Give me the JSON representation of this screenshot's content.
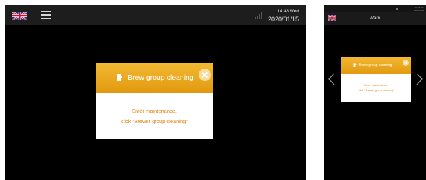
{
  "main_screen": {
    "status": {
      "time": "14:48 Wed",
      "date": "2020/01/15",
      "flag_icon": "uk-flag-icon",
      "menu_icon": "hamburger-menu-icon",
      "signal_icon": "signal-strength-icon"
    },
    "dialog": {
      "title": "Brew group cleaning",
      "title_icon": "brew-group-icon",
      "close_icon": "close-icon",
      "message_line1": "Enter maintenance,",
      "message_line2": "click \"Brewer group cleaning\""
    }
  },
  "side_screen": {
    "status_text_line1": "14:18 Thu",
    "status_text_line2": "2020/01/16",
    "header_title": "Warn",
    "flag_icon": "uk-flag-icon",
    "arrow_left_icon": "chevron-left-icon",
    "arrow_right_icon": "chevron-right-icon",
    "dialog": {
      "title": "Brew group cleaning",
      "title_icon": "brew-group-icon",
      "close_icon": "close-icon",
      "message_line1": "Enter maintenance,",
      "message_line2": "click \"Brewer group cleaning\""
    }
  },
  "colors": {
    "dialog_header": "#e8a51c",
    "message_text": "#e0841c",
    "background": "#000000"
  }
}
